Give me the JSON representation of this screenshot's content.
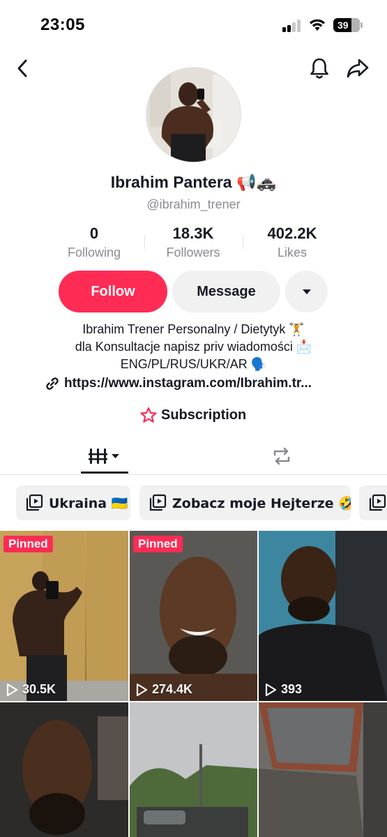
{
  "status_bar": {
    "time": "23:05",
    "battery": "39"
  },
  "profile": {
    "name": "Ibrahim Pantera",
    "name_emoji": "📢🚓",
    "handle": "@ibrahim_trener",
    "stats": [
      {
        "value": "0",
        "label": "Following"
      },
      {
        "value": "18.3K",
        "label": "Followers"
      },
      {
        "value": "402.2K",
        "label": "Likes"
      }
    ]
  },
  "actions": {
    "follow": "Follow",
    "message": "Message"
  },
  "bio": {
    "lines": [
      "Ibrahim Trener Personalny / Dietytyk 🏋️",
      "dla Konsultacje napisz priv wiadomości 📩",
      "ENG/PL/RUS/UKR/AR 🗣️"
    ],
    "link": "https://www.instagram.com/Ibrahim.tr...",
    "subscription": "Subscription"
  },
  "playlists": [
    {
      "label": "Ukraina 🇺🇦"
    },
    {
      "label": "Zobacz moje Hejterze 🤣"
    }
  ],
  "videos": [
    {
      "pinned": "Pinned",
      "views": "30.5K"
    },
    {
      "pinned": "Pinned",
      "views": "274.4K"
    },
    {
      "pinned": "",
      "views": "393"
    },
    {
      "pinned": "",
      "views": ""
    },
    {
      "pinned": "",
      "views": ""
    },
    {
      "pinned": "",
      "views": ""
    }
  ],
  "colors": {
    "accent": "#fe2c55",
    "text": "#161823",
    "muted": "#8a8b91",
    "chip_bg": "#f1f1f2"
  }
}
